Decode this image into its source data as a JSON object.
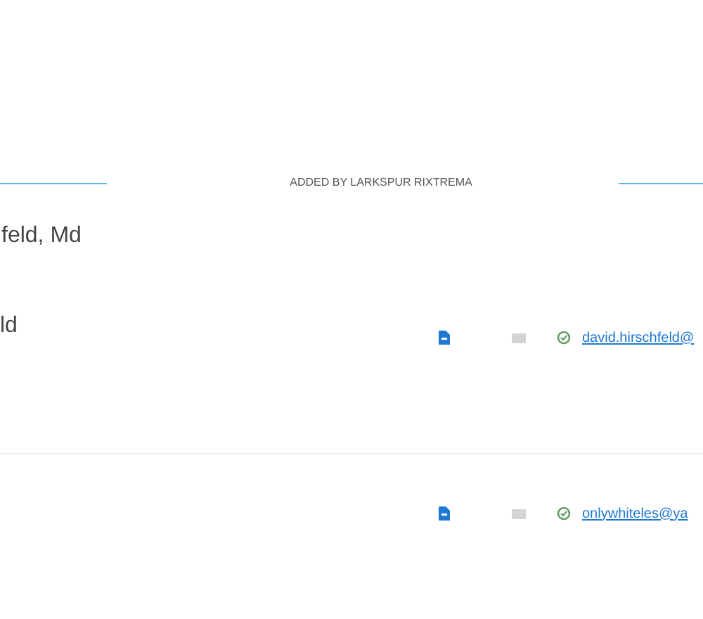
{
  "section_header": "ADDED BY LARKSPUR RIXTREMA",
  "contacts": [
    {
      "name": "feld, Md",
      "subname": "ld",
      "email": "david.hirschfeld@",
      "verified": true
    },
    {
      "email": "onlywhiteles@ya",
      "verified": true
    }
  ]
}
